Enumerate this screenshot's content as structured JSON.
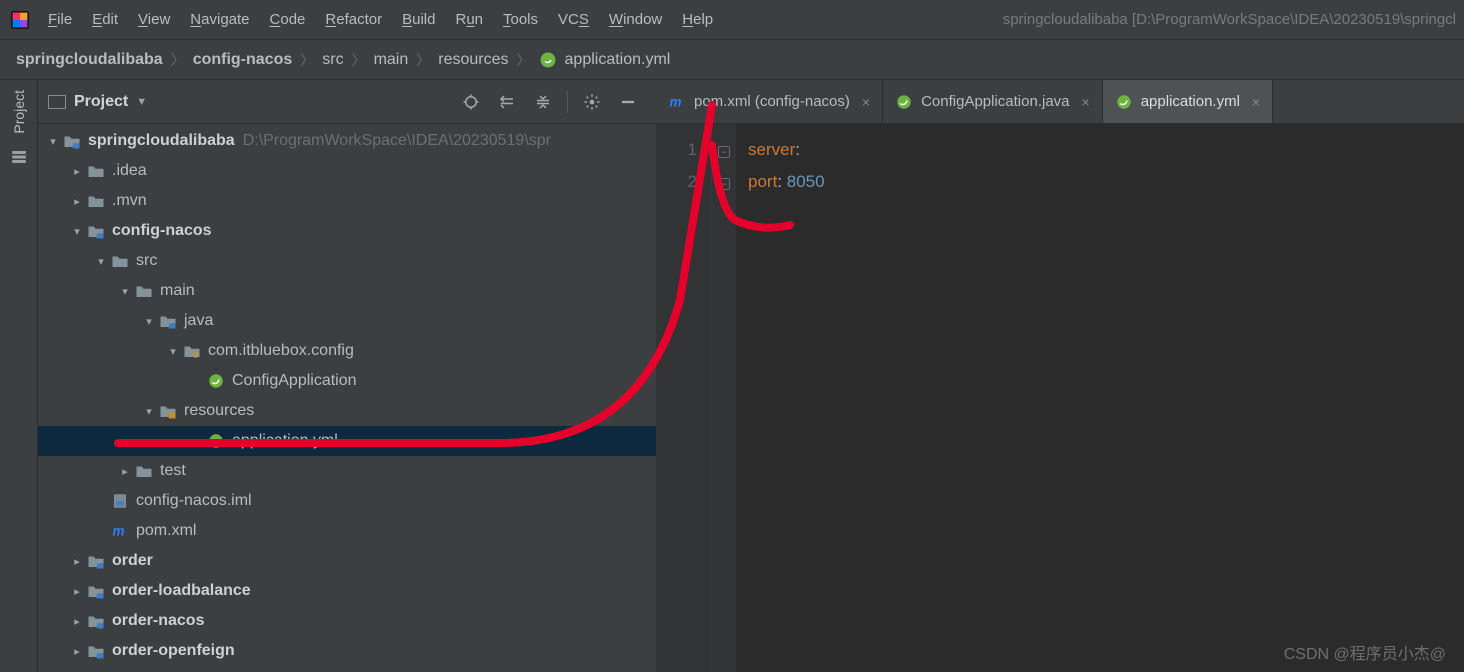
{
  "menubar": {
    "items": [
      "File",
      "Edit",
      "View",
      "Navigate",
      "Code",
      "Refactor",
      "Build",
      "Run",
      "Tools",
      "VCS",
      "Window",
      "Help"
    ],
    "window_title": "springcloudalibaba [D:\\ProgramWorkSpace\\IDEA\\20230519\\springcl"
  },
  "breadcrumb": {
    "items": [
      "springcloudalibaba",
      "config-nacos",
      "src",
      "main",
      "resources",
      "application.yml"
    ]
  },
  "left_gutter": {
    "project_label": "Project"
  },
  "project_panel": {
    "title": "Project",
    "root_hint": "D:\\ProgramWorkSpace\\IDEA\\20230519\\spr"
  },
  "tree": [
    {
      "indent": 0,
      "arrow": "down",
      "icon": "folder-blue",
      "label": "springcloudalibaba",
      "bold": true,
      "hint": "D:\\ProgramWorkSpace\\IDEA\\20230519\\spr"
    },
    {
      "indent": 1,
      "arrow": "right",
      "icon": "folder",
      "label": ".idea"
    },
    {
      "indent": 1,
      "arrow": "right",
      "icon": "folder",
      "label": ".mvn"
    },
    {
      "indent": 1,
      "arrow": "down",
      "icon": "folder-blue",
      "label": "config-nacos",
      "bold": true
    },
    {
      "indent": 2,
      "arrow": "down",
      "icon": "folder",
      "label": "src"
    },
    {
      "indent": 3,
      "arrow": "down",
      "icon": "folder",
      "label": "main"
    },
    {
      "indent": 4,
      "arrow": "down",
      "icon": "folder-blue",
      "label": "java"
    },
    {
      "indent": 5,
      "arrow": "down",
      "icon": "package",
      "label": "com.itbluebox.config"
    },
    {
      "indent": 6,
      "arrow": "none",
      "icon": "spring",
      "label": "ConfigApplication"
    },
    {
      "indent": 4,
      "arrow": "down",
      "icon": "resources",
      "label": "resources"
    },
    {
      "indent": 6,
      "arrow": "none",
      "icon": "spring",
      "label": "application.yml",
      "selected": true
    },
    {
      "indent": 3,
      "arrow": "right",
      "icon": "folder",
      "label": "test"
    },
    {
      "indent": 2,
      "arrow": "none",
      "icon": "iml",
      "label": "config-nacos.iml"
    },
    {
      "indent": 2,
      "arrow": "none",
      "icon": "maven",
      "label": "pom.xml"
    },
    {
      "indent": 1,
      "arrow": "right",
      "icon": "folder-blue",
      "label": "order",
      "bold": true
    },
    {
      "indent": 1,
      "arrow": "right",
      "icon": "folder-blue",
      "label": "order-loadbalance",
      "bold": true
    },
    {
      "indent": 1,
      "arrow": "right",
      "icon": "folder-blue",
      "label": "order-nacos",
      "bold": true
    },
    {
      "indent": 1,
      "arrow": "right",
      "icon": "folder-blue",
      "label": "order-openfeign",
      "bold": true
    }
  ],
  "editor_tabs": [
    {
      "icon": "maven",
      "label": "pom.xml (config-nacos)",
      "active": false
    },
    {
      "icon": "spring",
      "label": "ConfigApplication.java",
      "active": false
    },
    {
      "icon": "spring",
      "label": "application.yml",
      "active": true
    }
  ],
  "code": {
    "lines": [
      {
        "n": "1",
        "segments": [
          {
            "t": "server",
            "c": "cy"
          },
          {
            "t": ":",
            "c": "cp"
          }
        ]
      },
      {
        "n": "2",
        "segments": [
          {
            "t": "  port",
            "c": "cy"
          },
          {
            "t": ": ",
            "c": "cp"
          },
          {
            "t": "8050",
            "c": "cv"
          }
        ]
      }
    ]
  },
  "watermark": "CSDN @程序员小杰@"
}
